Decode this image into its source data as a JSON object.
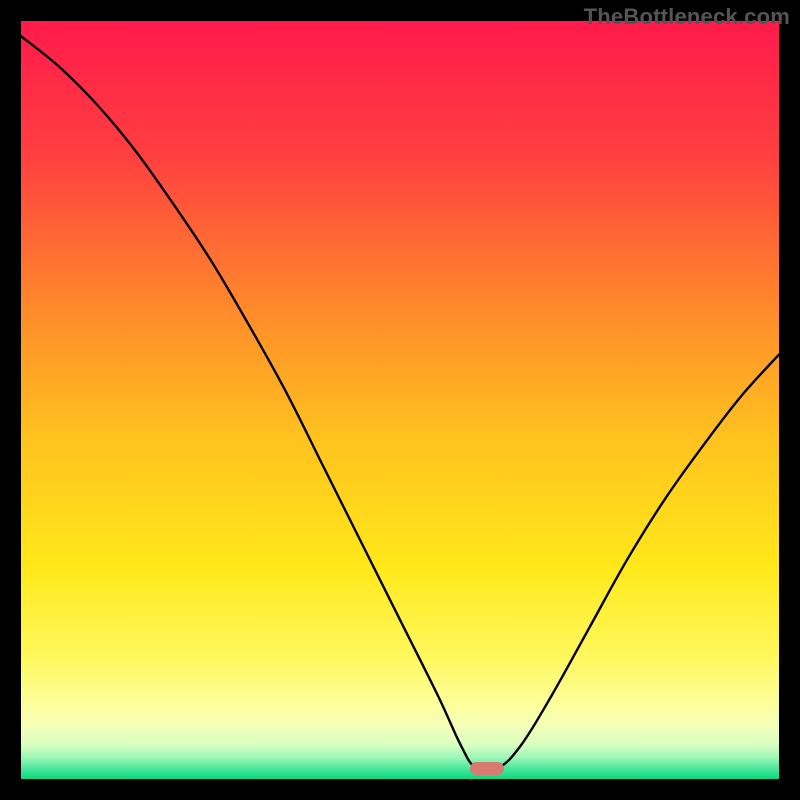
{
  "watermark": "TheBottleneck.com",
  "chart_data": {
    "type": "line",
    "title": "",
    "xlabel": "",
    "ylabel": "",
    "xlim": [
      0,
      100
    ],
    "ylim": [
      0,
      100
    ],
    "series": [
      {
        "name": "bottleneck-curve",
        "x": [
          0,
          5,
          10,
          15,
          20,
          25,
          30,
          35,
          40,
          45,
          50,
          55,
          58,
          60,
          63,
          66,
          70,
          75,
          80,
          85,
          90,
          95,
          100
        ],
        "values": [
          98,
          94,
          89,
          83,
          76,
          68.5,
          60,
          51,
          41,
          31,
          21,
          11,
          4.5,
          1.5,
          1.5,
          4.5,
          11,
          20,
          29,
          37,
          44,
          50.5,
          56
        ]
      }
    ],
    "marker": {
      "x": 61.5,
      "y": 1.4,
      "width_pct": 4.5,
      "color": "#d77a70"
    },
    "gradient_stops": [
      {
        "pct": 0,
        "color": "#ff1a4b"
      },
      {
        "pct": 18,
        "color": "#ff4040"
      },
      {
        "pct": 38,
        "color": "#ff8a2a"
      },
      {
        "pct": 55,
        "color": "#ffc21f"
      },
      {
        "pct": 72,
        "color": "#ffe81a"
      },
      {
        "pct": 84,
        "color": "#fff85e"
      },
      {
        "pct": 90,
        "color": "#fdff9a"
      },
      {
        "pct": 93,
        "color": "#f4ffb8"
      },
      {
        "pct": 95.5,
        "color": "#d8ffc0"
      },
      {
        "pct": 97.2,
        "color": "#9cf7b8"
      },
      {
        "pct": 98.6,
        "color": "#4be89c"
      },
      {
        "pct": 100,
        "color": "#08d97e"
      }
    ]
  }
}
